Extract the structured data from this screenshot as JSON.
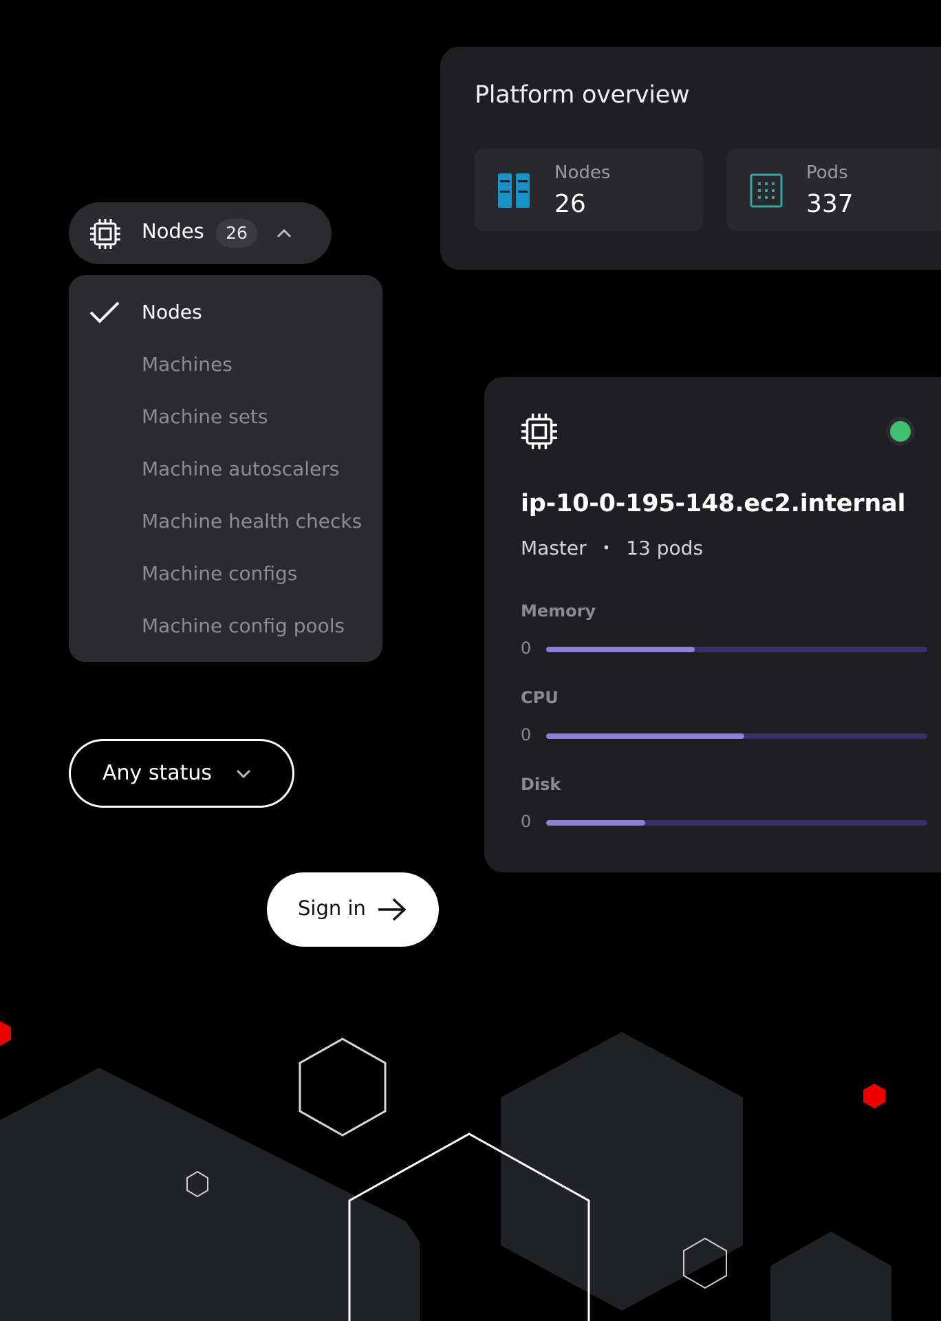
{
  "overview": {
    "title": "Platform overview",
    "stats": [
      {
        "label": "Nodes",
        "value": "26",
        "icon": "server-rack-icon"
      },
      {
        "label": "Pods",
        "value": "337",
        "icon": "pods-grid-icon"
      }
    ]
  },
  "nodes_filter": {
    "label": "Nodes",
    "count": "26",
    "icon": "cpu-chip-icon"
  },
  "menu": {
    "items": [
      {
        "label": "Nodes",
        "selected": true
      },
      {
        "label": "Machines",
        "selected": false
      },
      {
        "label": "Machine sets",
        "selected": false
      },
      {
        "label": "Machine autoscalers",
        "selected": false
      },
      {
        "label": "Machine health checks",
        "selected": false
      },
      {
        "label": "Machine configs",
        "selected": false
      },
      {
        "label": "Machine config pools",
        "selected": false
      }
    ]
  },
  "status_filter": {
    "label": "Any status"
  },
  "node_card": {
    "name": "ip-10-0-195-148.ec2.internal",
    "role": "Master",
    "separator": "•",
    "pods": "13 pods",
    "status_color": "#3fbf6f",
    "metrics": [
      {
        "label": "Memory",
        "min": "0",
        "fraction": 0.39
      },
      {
        "label": "CPU",
        "min": "0",
        "fraction": 0.52
      },
      {
        "label": "Disk",
        "min": "0",
        "fraction": 0.26
      }
    ]
  },
  "signin": {
    "label": "Sign in"
  },
  "colors": {
    "accent_red": "#ee0000",
    "bar_fill": "#8f7fd6",
    "bar_track": "#35306a",
    "icon_blue": "#1793c8",
    "icon_teal": "#37a3a3"
  }
}
